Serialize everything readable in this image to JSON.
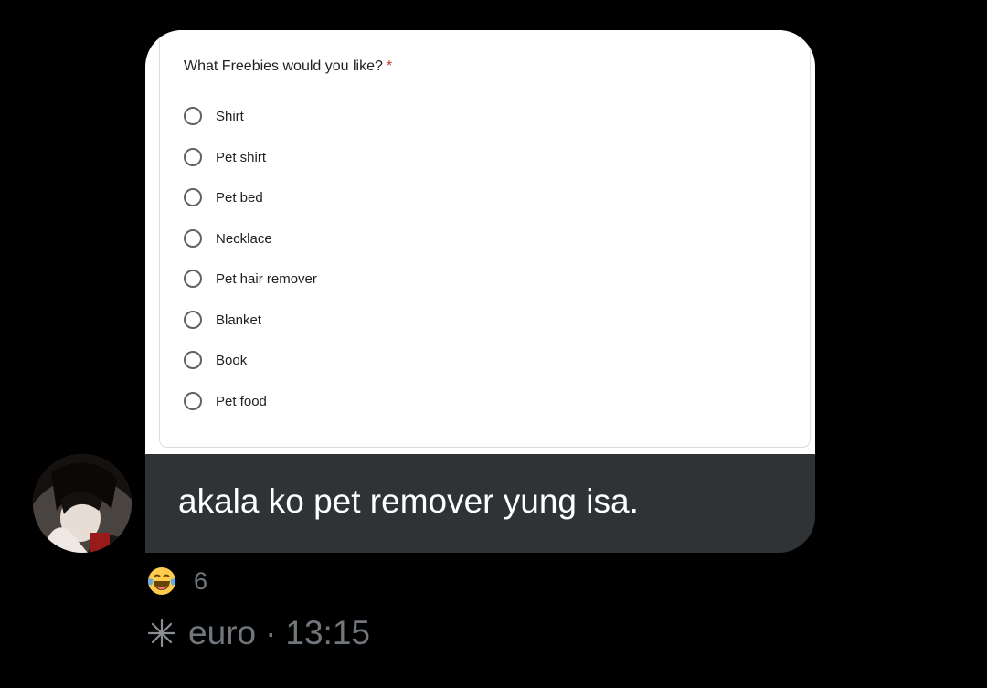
{
  "form": {
    "question": "What Freebies would you like?",
    "required_mark": "*",
    "options": [
      "Shirt",
      "Pet shirt",
      "Pet bed",
      "Necklace",
      "Pet hair remover",
      "Blanket",
      "Book",
      "Pet food"
    ]
  },
  "message": {
    "text": "akala ko pet remover yung isa."
  },
  "reaction": {
    "emoji": "laughing-crying-emoji",
    "count": "6"
  },
  "meta": {
    "sender": "euro",
    "separator": "·",
    "time": "13:15"
  },
  "colors": {
    "background": "#000000",
    "bubble": "#2f3336",
    "muted_text": "#71767b",
    "required": "#d93025"
  }
}
